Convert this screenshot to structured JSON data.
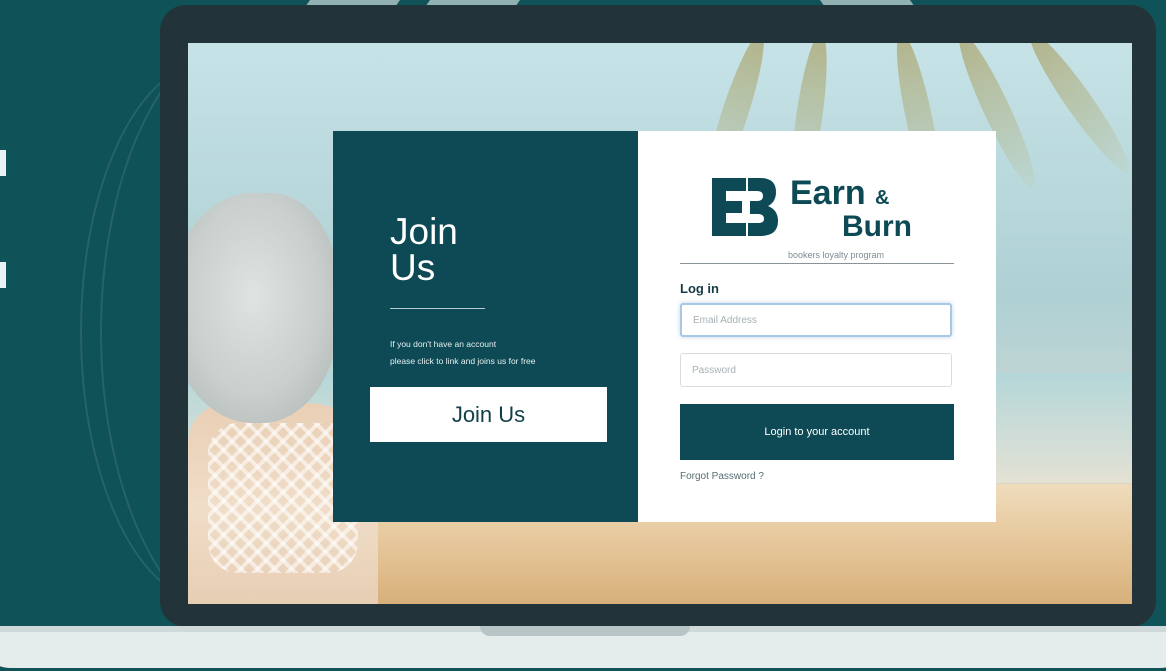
{
  "join": {
    "heading_line1": "Join",
    "heading_line2": "Us",
    "text_line1": "If you don't have an account",
    "text_line2": "please click to link and joins us for free",
    "button_label": "Join Us"
  },
  "brand": {
    "mark": "EB",
    "name_line1": "Earn",
    "ampersand": "&",
    "name_line2": "Burn",
    "tagline": "bookers loyalty program"
  },
  "login": {
    "title": "Log in",
    "email_placeholder": "Email Address",
    "password_placeholder": "Password",
    "submit_label": "Login to your account",
    "forgot_label": "Forgot Password ?"
  },
  "colors": {
    "primary": "#0d4a55",
    "page_background": "#0f5257",
    "panel_white": "#ffffff",
    "input_focus": "#a8c8e6"
  },
  "icons": {
    "logo": "eb-logo-icon"
  }
}
